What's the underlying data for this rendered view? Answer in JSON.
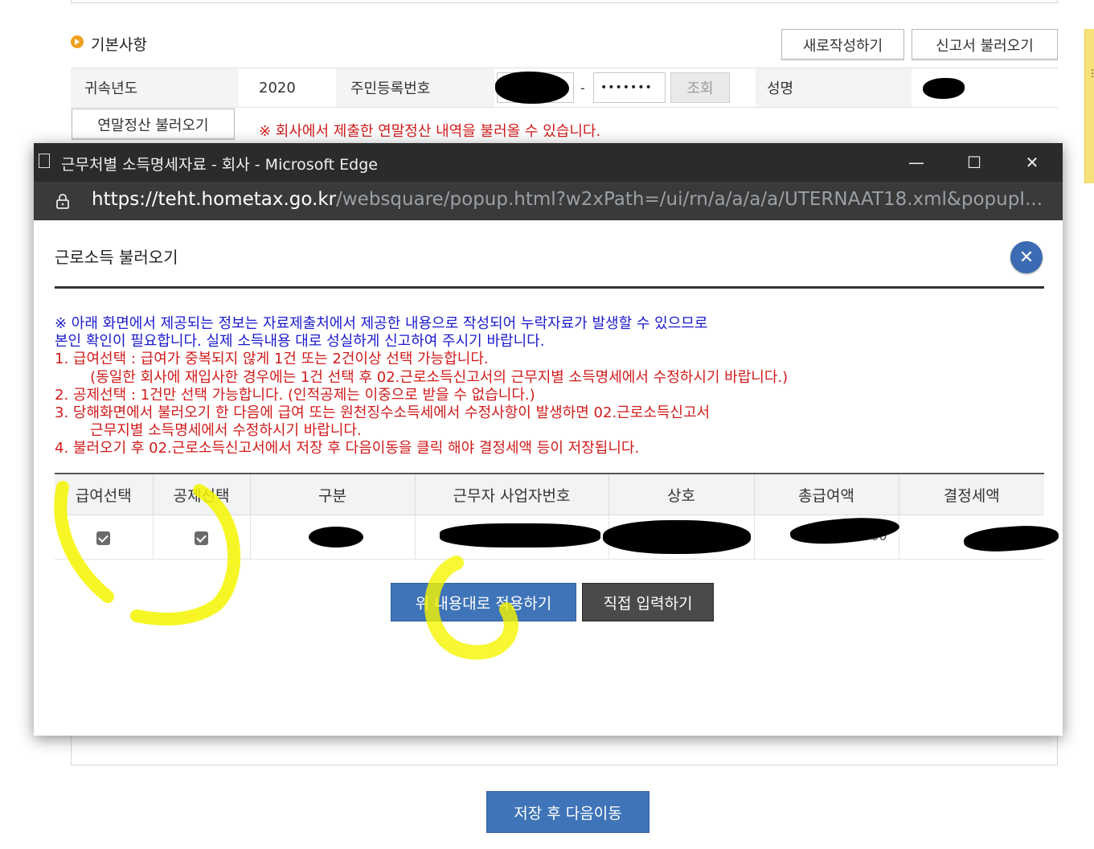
{
  "page": {
    "section_title": "기본사항",
    "new_btn": "새로작성하기",
    "load_report_btn": "신고서 불러오기",
    "year_label": "귀속년도",
    "year_value": "2020",
    "ssn_label": "주민등록번호",
    "ssn_dash": "-",
    "ssn_back_masked": "•••••••",
    "lookup_btn": "조회",
    "name_label": "성명",
    "year_end_btn": "연말정산 불러오기",
    "year_end_notice": "※ 회사에서 제출한 연말정산 내역을 불러올 수 있습니다.",
    "save_next_btn": "저장 후 다음이동"
  },
  "popup": {
    "window_title": "근무처별 소득명세자료 - 회사 - Microsoft Edge",
    "controls": {
      "minimize": "—",
      "maximize": "☐",
      "close": "✕"
    },
    "url_proto": "https://",
    "url_host": "teht.hometax.go.kr",
    "url_path": "/websquare/popup.html?w2xPath=/ui/rn/a/a/a/a/UTERNAAT18.xml&popupI...",
    "content_title": "근로소득 불러오기",
    "close_icon": "✕",
    "notice": {
      "blue_1": "※ 아래 화면에서 제공되는 정보는 자료제출처에서 제공한 내용으로 작성되어 누락자료가 발생할 수 있으므로",
      "blue_2": "본인 확인이 필요합니다. 실제 소득내용 대로 성실하게 신고하여 주시기 바랍니다.",
      "red_1": "1. 급여선택 : 급여가 중복되지 않게 1건 또는 2건이상 선택 가능합니다.",
      "red_1b": "   (동일한 회사에 재입사한 경우에는 1건 선택 후 02.근로소득신고서의 근무지별 소득명세에서 수정하시기 바랍니다.)",
      "red_2": "2. 공제선택 : 1건만 선택 가능합니다. (인적공제는 이중으로 받을 수 없습니다.)",
      "red_3": "3. 당해화면에서 불러오기 한 다음에 급여 또는 원천징수소득세에서 수정사항이 발생하면 02.근로소득신고서",
      "red_3b": "   근무지별 소득명세에서 수정하시기 바랍니다.",
      "red_4": "4. 불러오기 후 02.근로소득신고서에서 저장 후 다음이동을 클릭 해야 결정세액 등이 저장됩니다."
    },
    "table": {
      "headers": [
        "급여선택",
        "공제선택",
        "구분",
        "근무자 사업자번호",
        "상호",
        "총급여액",
        "결정세액"
      ],
      "row": {
        "salary_checked": true,
        "deduction_checked": true,
        "total_tail": "00"
      }
    },
    "apply_btn": "위 내용대로 적용하기",
    "manual_btn": "직접 입력하기"
  },
  "colors": {
    "primary_blue": "#3f74b8",
    "notice_blue": "#1a1acc",
    "notice_red": "#d11b1b",
    "highlight": "#f5f500"
  }
}
